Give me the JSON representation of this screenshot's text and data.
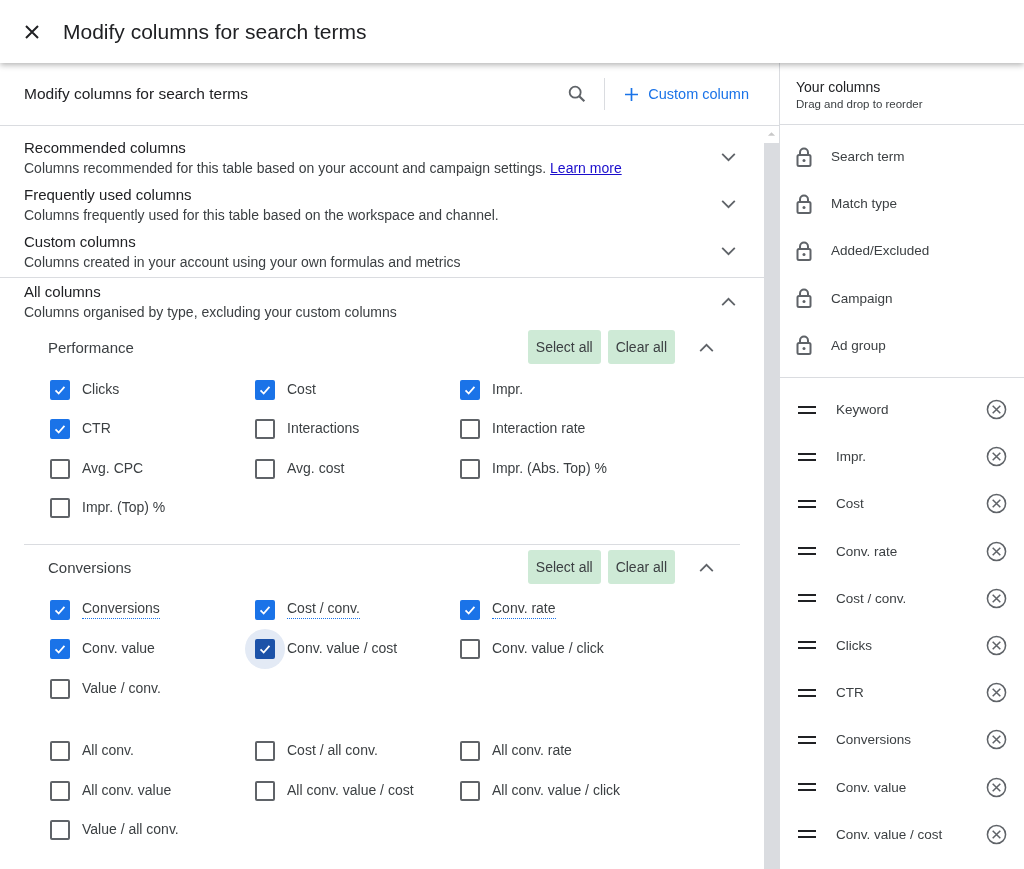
{
  "header": {
    "title": "Modify columns for search terms"
  },
  "panel": {
    "title": "Modify columns for search terms",
    "custom_column": "Custom column"
  },
  "categories": [
    {
      "title": "Recommended columns",
      "description": "Columns recommended for this table based on your account and campaign settings.",
      "link": "Learn more",
      "expanded": false
    },
    {
      "title": "Frequently used columns",
      "description": "Columns frequently used for this table based on the workspace and channel.",
      "expanded": false
    },
    {
      "title": "Custom columns",
      "description": "Columns created in your account using your own formulas and metrics",
      "expanded": false
    },
    {
      "title": "All columns",
      "description": "Columns organised by type, excluding your custom columns",
      "expanded": true
    }
  ],
  "groups": [
    {
      "title": "Performance",
      "select_all": "Select all",
      "clear_all": "Clear all",
      "expanded": true,
      "blocks": [
        [
          {
            "label": "Clicks",
            "checked": true,
            "hint": false,
            "focused": false
          },
          {
            "label": "Cost",
            "checked": true,
            "hint": false,
            "focused": false
          },
          {
            "label": "Impr.",
            "checked": true,
            "hint": false,
            "focused": false
          },
          {
            "label": "CTR",
            "checked": true,
            "hint": false,
            "focused": false
          },
          {
            "label": "Interactions",
            "checked": false,
            "hint": false,
            "focused": false
          },
          {
            "label": "Interaction rate",
            "checked": false,
            "hint": false,
            "focused": false
          },
          {
            "label": "Avg. CPC",
            "checked": false,
            "hint": false,
            "focused": false
          },
          {
            "label": "Avg. cost",
            "checked": false,
            "hint": false,
            "focused": false
          },
          {
            "label": "Impr. (Abs. Top) %",
            "checked": false,
            "hint": false,
            "focused": false
          },
          {
            "label": "Impr. (Top) %",
            "checked": false,
            "hint": false,
            "focused": false
          }
        ]
      ]
    },
    {
      "title": "Conversions",
      "select_all": "Select all",
      "clear_all": "Clear all",
      "expanded": true,
      "blocks": [
        [
          {
            "label": "Conversions",
            "checked": true,
            "hint": true,
            "focused": false
          },
          {
            "label": "Cost / conv.",
            "checked": true,
            "hint": true,
            "focused": false
          },
          {
            "label": "Conv. rate",
            "checked": true,
            "hint": true,
            "focused": false
          },
          {
            "label": "Conv. value",
            "checked": true,
            "hint": false,
            "focused": false
          },
          {
            "label": "Conv. value / cost",
            "checked": true,
            "hint": false,
            "focused": true
          },
          {
            "label": "Conv. value / click",
            "checked": false,
            "hint": false,
            "focused": false
          },
          {
            "label": "Value / conv.",
            "checked": false,
            "hint": false,
            "focused": false
          }
        ],
        [
          {
            "label": "All conv.",
            "checked": false,
            "hint": false,
            "focused": false
          },
          {
            "label": "Cost / all conv.",
            "checked": false,
            "hint": false,
            "focused": false
          },
          {
            "label": "All conv. rate",
            "checked": false,
            "hint": false,
            "focused": false
          },
          {
            "label": "All conv. value",
            "checked": false,
            "hint": false,
            "focused": false
          },
          {
            "label": "All conv. value / cost",
            "checked": false,
            "hint": false,
            "focused": false
          },
          {
            "label": "All conv. value / click",
            "checked": false,
            "hint": false,
            "focused": false
          },
          {
            "label": "Value / all conv.",
            "checked": false,
            "hint": false,
            "focused": false
          }
        ]
      ]
    }
  ],
  "your_columns": {
    "title": "Your columns",
    "subtitle": "Drag and drop to reorder",
    "locked": [
      "Search term",
      "Match type",
      "Added/Excluded",
      "Campaign",
      "Ad group"
    ],
    "columns": [
      "Keyword",
      "Impr.",
      "Cost",
      "Conv. rate",
      "Cost / conv.",
      "Clicks",
      "CTR",
      "Conversions",
      "Conv. value",
      "Conv. value / cost"
    ]
  }
}
